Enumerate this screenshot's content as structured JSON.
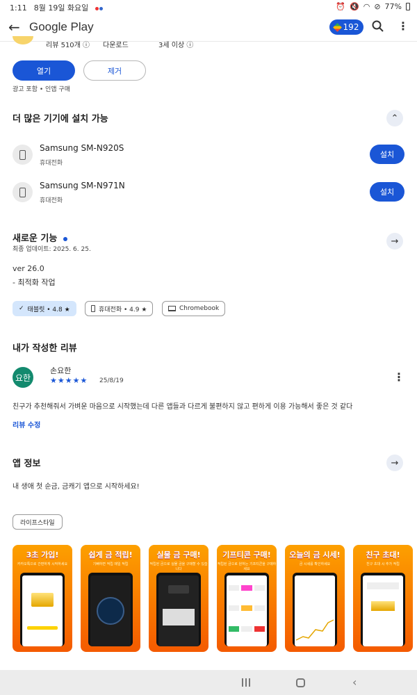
{
  "status_bar": {
    "time": "1:11",
    "date": "8월 19일 화요일",
    "battery": "77%"
  },
  "app_bar": {
    "title": "Google Play",
    "points": "192"
  },
  "summary": {
    "reviews": "리뷰 510개 ⓘ",
    "downloads": "다운로드",
    "age": "3세 이상 ⓘ"
  },
  "actions": {
    "open": "열기",
    "remove": "제거",
    "note": "광고 포함 • 인앱 구매"
  },
  "devices": {
    "title": "더 많은 기기에 설치 가능",
    "items": [
      {
        "name": "Samsung SM-N920S",
        "type": "휴대전화",
        "button": "설치"
      },
      {
        "name": "Samsung SM-N971N",
        "type": "휴대전화",
        "button": "설치"
      }
    ]
  },
  "whats_new": {
    "title": "새로운 기능",
    "updated": "최종 업데이트: 2025. 6. 25.",
    "version": "ver 26.0",
    "note": "- 최적화 작업"
  },
  "chips": [
    {
      "label": "태블릿 • 4.8 ★",
      "icon": "check-icon"
    },
    {
      "label": "휴대전화 • 4.9 ★",
      "icon": "phone-icon"
    },
    {
      "label": "Chromebook",
      "icon": "laptop-icon"
    }
  ],
  "my_review": {
    "title": "내가 작성한 리뷰",
    "avatar_text": "요한",
    "author": "손요한",
    "stars": "★★★★★",
    "date": "25/8/19",
    "text": "친구가 추천해줘서 가벼운 마음으로 시작했는데 다른 앱들과 다르게 불편하지 않고 편하게 이용 가능해서 좋은 것 같다",
    "edit": "리뷰 수정"
  },
  "app_info": {
    "title": "앱 정보",
    "description": "내 생애 첫 순금, 금캐기 앱으로 시작하세요!",
    "tag": "라이프스타일"
  },
  "screenshots": [
    {
      "caption": "3초 가입!",
      "sub": "카카오톡으로 간편하게 시작하세요"
    },
    {
      "caption": "쉽게 금 적립!",
      "sub": "기뻐하면 적립 매일 적립"
    },
    {
      "caption": "실물 금 구매!",
      "sub": "적립된 금으로 실물 금을 구매할 수 있습니다"
    },
    {
      "caption": "기프티콘 구매!",
      "sub": "적립된 금으로 원하는 기프티콘을 구매하세요"
    },
    {
      "caption": "오늘의 금 시세!",
      "sub": "금 시세를 확인하세요"
    },
    {
      "caption": "친구 초대!",
      "sub": "친구 초대 시 추가 적립"
    }
  ],
  "colors": {
    "accent": "#1a56d6",
    "avatar": "#138a6e",
    "chip_selected": "#d4e6fc"
  }
}
